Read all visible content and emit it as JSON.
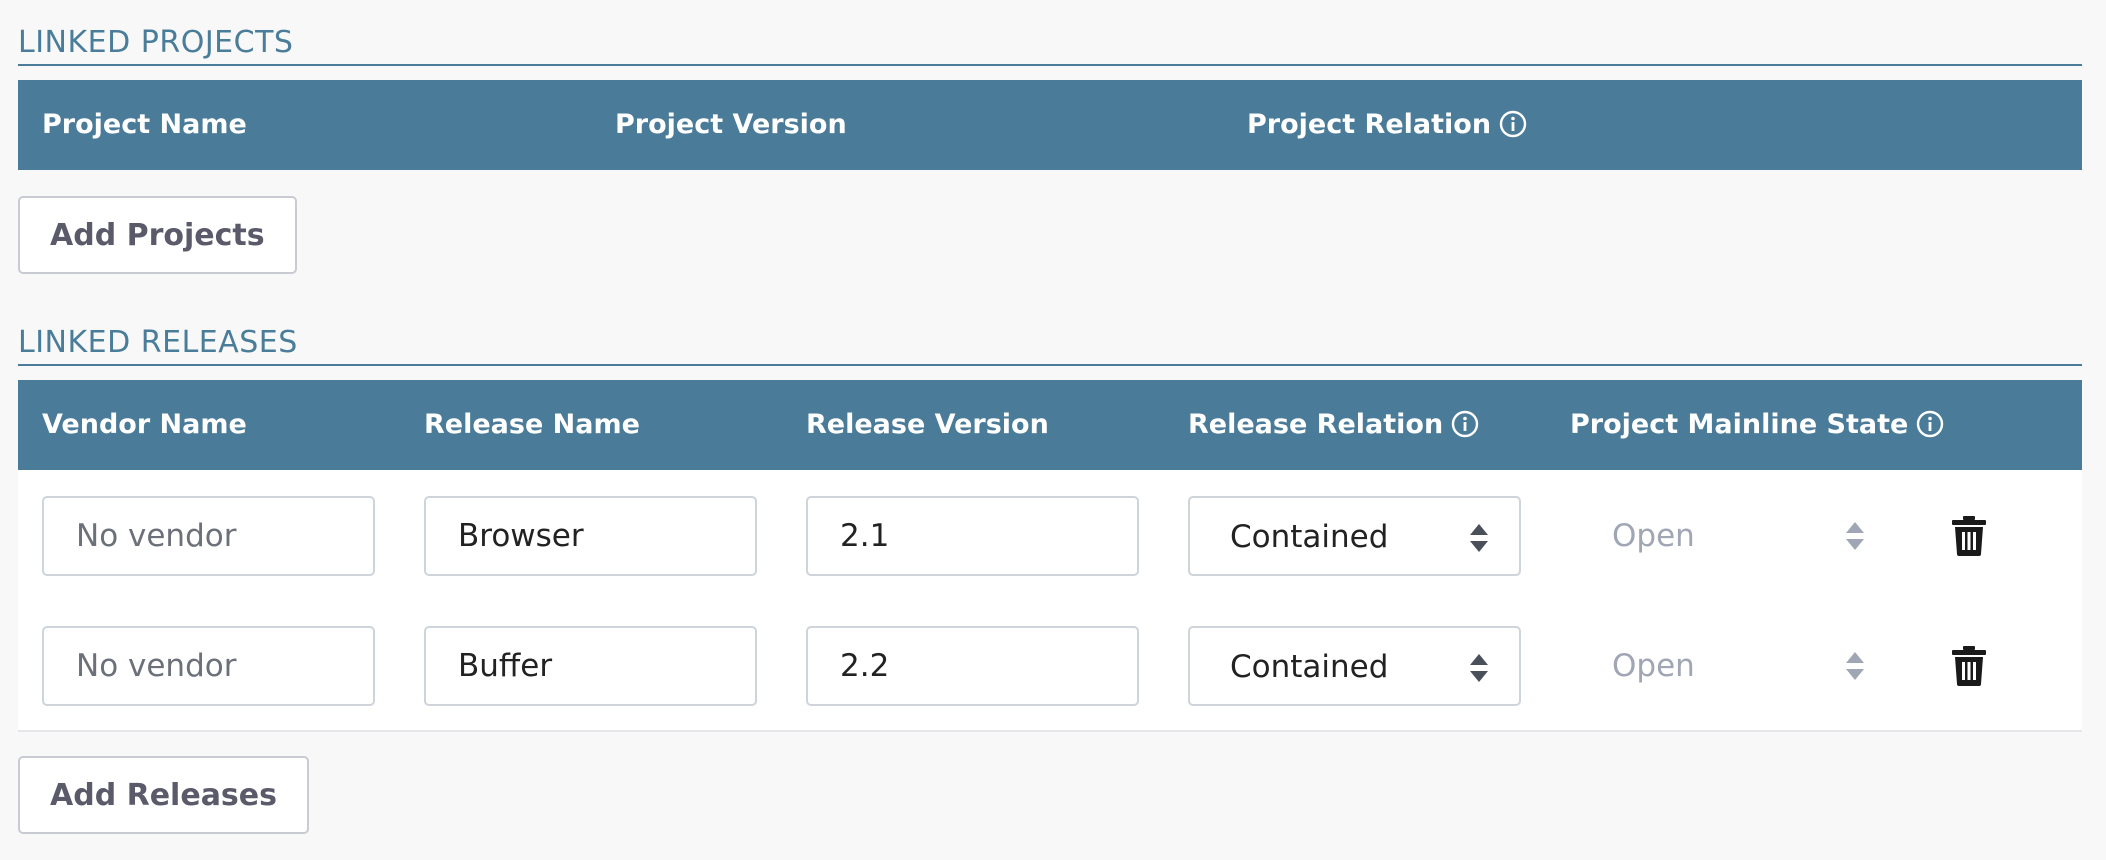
{
  "linked_projects": {
    "title": "LINKED PROJECTS",
    "columns": {
      "project_name": "Project Name",
      "project_version": "Project Version",
      "project_relation": "Project Relation"
    },
    "add_button": "Add Projects"
  },
  "linked_releases": {
    "title": "LINKED RELEASES",
    "columns": {
      "vendor_name": "Vendor Name",
      "release_name": "Release Name",
      "release_version": "Release Version",
      "release_relation": "Release Relation",
      "project_mainline_state": "Project Mainline State"
    },
    "rows": [
      {
        "vendor_placeholder": "No vendor",
        "release_name": "Browser",
        "release_version": "2.1",
        "release_relation": "Contained",
        "mainline_state": "Open",
        "delete_icon": "trash-icon"
      },
      {
        "vendor_placeholder": "No vendor",
        "release_name": "Buffer",
        "release_version": "2.2",
        "release_relation": "Contained",
        "mainline_state": "Open",
        "delete_icon": "trash-icon"
      }
    ],
    "add_button": "Add Releases"
  },
  "colors": {
    "header_bg": "#4a7b99",
    "section_title": "#4a7d99",
    "page_bg": "#f8f8f8"
  }
}
